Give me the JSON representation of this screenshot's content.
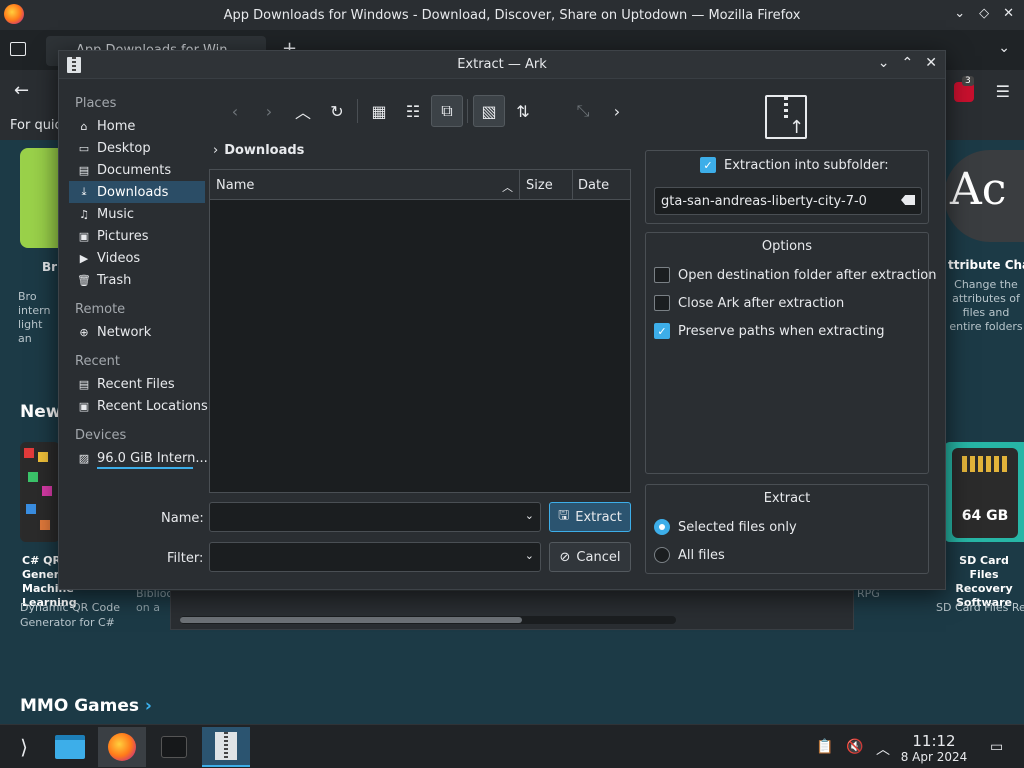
{
  "firefox": {
    "window_title": "App Downloads for Windows - Download, Discover, Share on Uptodown — Mozilla Firefox",
    "tab_title": "App Downloads for Win",
    "extension_badge": "3",
    "bookmarks_text": "For quic"
  },
  "webpage": {
    "left_card_title": "Bri",
    "left_card_desc": "Bro intern light an",
    "ac_logo_text": "Ac",
    "right_card_title": "ttribute Changer",
    "right_card_desc": "Change the attributes of files and entire folders",
    "new_heading": "New",
    "qr_title": "C# QR Code Generator for Machine Learning",
    "qr_desc": "Dynamic QR Code Generator for C#",
    "mid_desc": "Biblioc on a",
    "rpg_text": "RPG",
    "sd_label": "64 GB",
    "sd_title": "SD Card Files Recovery Software",
    "sd_desc": "SD Card Files Recovery Software restor...",
    "mmo_heading": "MMO Games"
  },
  "dialog": {
    "title": "Extract — Ark",
    "places": {
      "places_header": "Places",
      "places_items": [
        "Home",
        "Desktop",
        "Documents",
        "Downloads",
        "Music",
        "Pictures",
        "Videos",
        "Trash"
      ],
      "selected": "Downloads",
      "remote_header": "Remote",
      "remote_items": [
        "Network"
      ],
      "recent_header": "Recent",
      "recent_items": [
        "Recent Files",
        "Recent Locations"
      ],
      "devices_header": "Devices",
      "devices_items": [
        "96.0 GiB Intern..."
      ]
    },
    "breadcrumb": "Downloads",
    "columns": {
      "name": "Name",
      "size": "Size",
      "date": "Date"
    },
    "name_label": "Name:",
    "filter_label": "Filter:",
    "name_value": "",
    "filter_value": "",
    "extract_button": "Extract",
    "cancel_button": "Cancel",
    "subfolder_label": "Extraction into subfolder:",
    "subfolder_checked": true,
    "subfolder_value": "gta-san-andreas-liberty-city-7-0",
    "options_title": "Options",
    "options": [
      {
        "label": "Open destination folder after extraction",
        "checked": false
      },
      {
        "label": "Close Ark after extraction",
        "checked": false
      },
      {
        "label": "Preserve paths when extracting",
        "checked": true
      }
    ],
    "extract_group_title": "Extract",
    "extract_modes": [
      {
        "label": "Selected files only",
        "selected": true
      },
      {
        "label": "All files",
        "selected": false
      }
    ]
  },
  "taskbar": {
    "time": "11:12",
    "date": "8 Apr 2024"
  },
  "colors": {
    "accent": "#3daee9",
    "selection": "#2b4d66",
    "web_background": "#1c3a46"
  }
}
